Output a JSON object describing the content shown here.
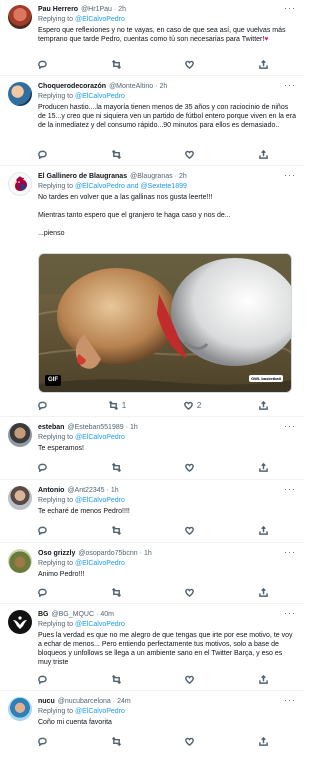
{
  "icons": {
    "reply": "reply-icon",
    "retweet": "retweet-icon",
    "like": "heart-icon",
    "share": "share-icon",
    "more": "more-icon"
  },
  "colors": {
    "link": "#1d9bf0",
    "muted": "#536471",
    "heart": "#f91880"
  },
  "tweets": [
    {
      "name": "Pau Herrero",
      "handle": "@Hr1Pau",
      "time": "2h",
      "replying_prefix": "Replying to",
      "replying_to": "@ElCalvoPedro",
      "text": [
        "Espero que reflexiones y no te vayas, en caso de que sea así, que vuelvas más temprano que tarde Pedro, cuentas como tú son necesarias para Twitter!"
      ],
      "emoji": "♥",
      "counts": {
        "reply": "",
        "retweet": "",
        "like": ""
      }
    },
    {
      "name": "Choquerodecorazón",
      "handle": "@MonteAltino",
      "time": "2h",
      "replying_prefix": "Replying to",
      "replying_to": "@ElCalvoPedro",
      "text": [
        "Producen hastio....la mayoría tienen menos de 35 años y con raciocinio de niños de 15...y creo que ni siquiera ven un partido de fútbol entero porque viven en la era de la inmediatez y del consumo rápido...90 minutos para ellos es demasiado.."
      ],
      "counts": {
        "reply": "",
        "retweet": "",
        "like": ""
      }
    },
    {
      "name": "El Gallinero de Blaugranas",
      "handle": "@Blaugranas",
      "time": "2h",
      "replying_prefix": "Replying to",
      "replying_to": "@ElCalvoPedro and @Sextete1899",
      "text": [
        "No tardes en volver que a las gallinas nos gusta leerte!!!",
        "Mientras tanto espero que el granjero te haga caso y nos de...",
        "...pienso"
      ],
      "media": {
        "badge": "GIF",
        "watermark": "OWL\nbasketball"
      },
      "counts": {
        "reply": "",
        "retweet": "1",
        "like": "2"
      }
    },
    {
      "name": "esteban",
      "handle": "@Esteban551989",
      "time": "1h",
      "replying_prefix": "Replying to",
      "replying_to": "@ElCalvoPedro",
      "text": [
        "Te esperamos!"
      ],
      "counts": {
        "reply": "",
        "retweet": "",
        "like": ""
      }
    },
    {
      "name": "Antonio",
      "handle": "@Ant22345",
      "time": "1h",
      "replying_prefix": "Replying to",
      "replying_to": "@ElCalvoPedro",
      "text": [
        "Te echaré de menos Pedro!!!!"
      ],
      "counts": {
        "reply": "",
        "retweet": "",
        "like": ""
      }
    },
    {
      "name": "Oso grizzly",
      "handle": "@osopardo75bcnn",
      "time": "1h",
      "replying_prefix": "Replying to",
      "replying_to": "@ElCalvoPedro",
      "text": [
        "Animo Pedro!!!"
      ],
      "counts": {
        "reply": "",
        "retweet": "",
        "like": ""
      }
    },
    {
      "name": "BG",
      "handle": "@BG_MQUC",
      "time": "40m",
      "replying_prefix": "Replying to",
      "replying_to": "@ElCalvoPedro",
      "text": [
        "Pues la verdad es que no me alegro de que tengas que irte por ese motivo, te voy a echar de menos... Pero entiendo perfectamente tus motivos, solo a base de bloqueos y unfollows se llega a un ambiente sano en el Twitter Barça, y eso es muy triste"
      ],
      "counts": {
        "reply": "",
        "retweet": "",
        "like": ""
      }
    },
    {
      "name": "nucu",
      "handle": "@nucubarcelona",
      "time": "24m",
      "replying_prefix": "Replying to",
      "replying_to": "@ElCalvoPedro",
      "text": [
        "Coño mi cuenta favorita"
      ],
      "counts": {
        "reply": "",
        "retweet": "",
        "like": ""
      }
    }
  ]
}
